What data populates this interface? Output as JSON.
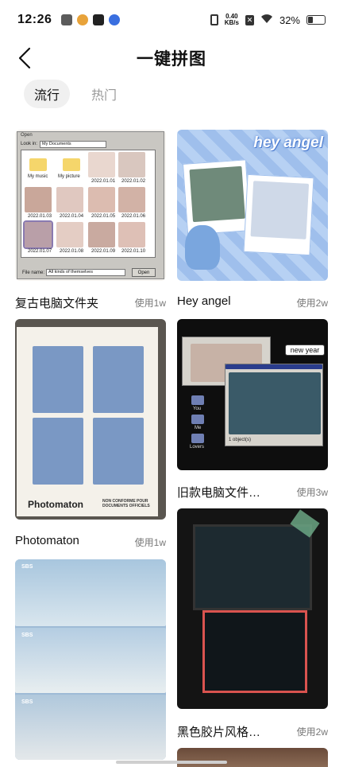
{
  "status": {
    "time": "12:26",
    "speed_value": "0.40",
    "speed_unit": "KB/s",
    "battery": "32%",
    "battery_level": 0.32
  },
  "header": {
    "title": "一键拼图"
  },
  "tabs": [
    {
      "label": "流行",
      "active": true
    },
    {
      "label": "热门",
      "active": false
    }
  ],
  "templates": [
    {
      "title": "复古电脑文件夹",
      "uses": "使用1w"
    },
    {
      "title": "Hey angel",
      "uses": "使用2w"
    },
    {
      "title": "Photomaton",
      "uses": "使用1w"
    },
    {
      "title": "旧款电脑文件…",
      "uses": "使用3w"
    },
    {
      "title": "黑色胶片风格…",
      "uses": "使用2w"
    }
  ],
  "thumb_text": {
    "retro_window": "Open",
    "retro_look_in": "Look in:",
    "retro_folder_path": "My Documents",
    "retro_folder1": "My music",
    "retro_folder2": "My picture",
    "retro_caps": [
      "2022.01.01",
      "2022.01.02",
      "2022.01.03",
      "2022.01.04",
      "2022.01.05",
      "2022.01.06",
      "2022.01.07",
      "2022.01.08",
      "2022.01.09",
      "2022.01.10"
    ],
    "retro_filename_label": "File name:",
    "retro_filename_value": "All kinds of themselves",
    "retro_open_btn": "Open",
    "angel_banner": "hey angel",
    "photomaton_brand": "Photomaton",
    "photomaton_note": "NON CONFORME POUR DOCUMENTS OFFICIELS",
    "oldpc_tag": "new year",
    "oldpc_folder1": "You",
    "oldpc_folder2": "Me",
    "oldpc_folder3": "Lovers",
    "oldpc_status": "1 object(s)",
    "sbs_logo": "SBS"
  },
  "colors": {
    "accent_blue": "#a9c8f2",
    "film_black": "#1a1a1a",
    "film_red": "#d9534f"
  }
}
